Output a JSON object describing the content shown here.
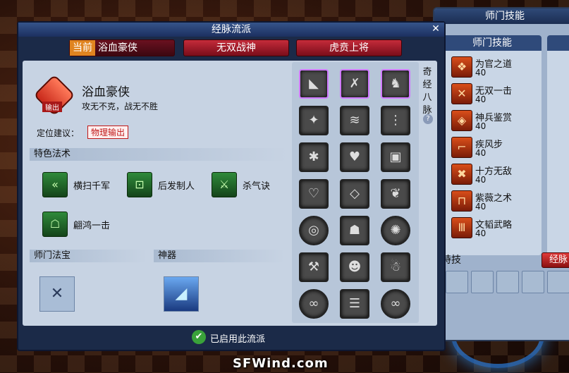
{
  "window": {
    "title": "经脉流派",
    "close_icon": "close-icon"
  },
  "tabs": [
    {
      "current_badge": "当前",
      "label": "浴血豪侠"
    },
    {
      "label": "无双战神"
    },
    {
      "label": "虎贲上将"
    }
  ],
  "school": {
    "icon_tag": "输出",
    "name": "浴血豪侠",
    "desc": "攻无不克，战无不胜",
    "position_label": "定位建议：",
    "position_tag": "物理输出"
  },
  "sections": {
    "spells": "特色法术",
    "treasure": "师门法宝",
    "artifact": "神器"
  },
  "spells": [
    {
      "name": "横扫千军",
      "icon": "triple-chevron-icon"
    },
    {
      "name": "后发制人",
      "icon": "square-rune-icon"
    },
    {
      "name": "杀气诀",
      "icon": "blade-icon"
    },
    {
      "name": "翩鸿一击",
      "icon": "warrior-icon"
    }
  ],
  "grid_label": "奇经八脉",
  "help_icon": "?",
  "footer_text": "已启用此流派",
  "right_panel": {
    "title": "师门技能",
    "skills_header": "师门技能",
    "skills": [
      {
        "name": "为官之道",
        "level": "40"
      },
      {
        "name": "无双一击",
        "level": "40"
      },
      {
        "name": "神兵鉴赏",
        "level": "40"
      },
      {
        "name": "疾风步",
        "level": "40"
      },
      {
        "name": "十方无敌",
        "level": "40"
      },
      {
        "name": "紫薇之术",
        "level": "40"
      },
      {
        "name": "文韬武略",
        "level": "40"
      }
    ],
    "special_label": "特技",
    "jingmai_button": "经脉"
  },
  "watermark": "SFWind.com"
}
